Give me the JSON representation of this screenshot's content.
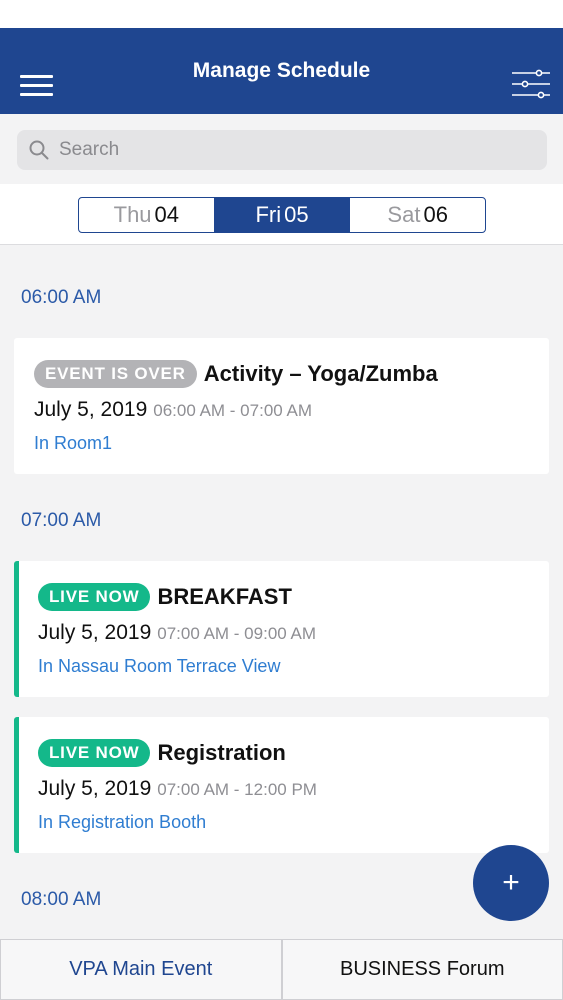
{
  "nav": {
    "title": "Manage Schedule"
  },
  "search": {
    "placeholder": "Search"
  },
  "dates": [
    {
      "dow": "Thu",
      "day": "04"
    },
    {
      "dow": "Fri",
      "day": "05",
      "selected": true
    },
    {
      "dow": "Sat",
      "day": "06"
    }
  ],
  "sections": [
    {
      "time": "06:00 AM",
      "events": [
        {
          "badge": "EVENT IS OVER",
          "title": "Activity – Yoga/Zumba",
          "date": "July 5, 2019",
          "time": "06:00 AM - 07:00 AM",
          "room": "In Room1"
        }
      ]
    },
    {
      "time": "07:00 AM",
      "events": [
        {
          "badge": "LIVE NOW",
          "title": "BREAKFAST",
          "date": "July 5, 2019",
          "time": "07:00 AM - 09:00 AM",
          "room": "In Nassau Room Terrace View"
        },
        {
          "badge": "LIVE NOW",
          "title": "Registration",
          "date": "July 5, 2019",
          "time": "07:00 AM - 12:00 PM",
          "room": "In Registration Booth"
        }
      ]
    },
    {
      "time": "08:00 AM",
      "events": []
    }
  ],
  "fab": {
    "label": "+"
  },
  "bottom_tabs": [
    "VPA Main Event",
    "BUSINESS Forum"
  ],
  "colors": {
    "primary": "#1f4690",
    "live": "#14b88a",
    "over": "#b3b3b6",
    "link": "#2f7dd1"
  }
}
